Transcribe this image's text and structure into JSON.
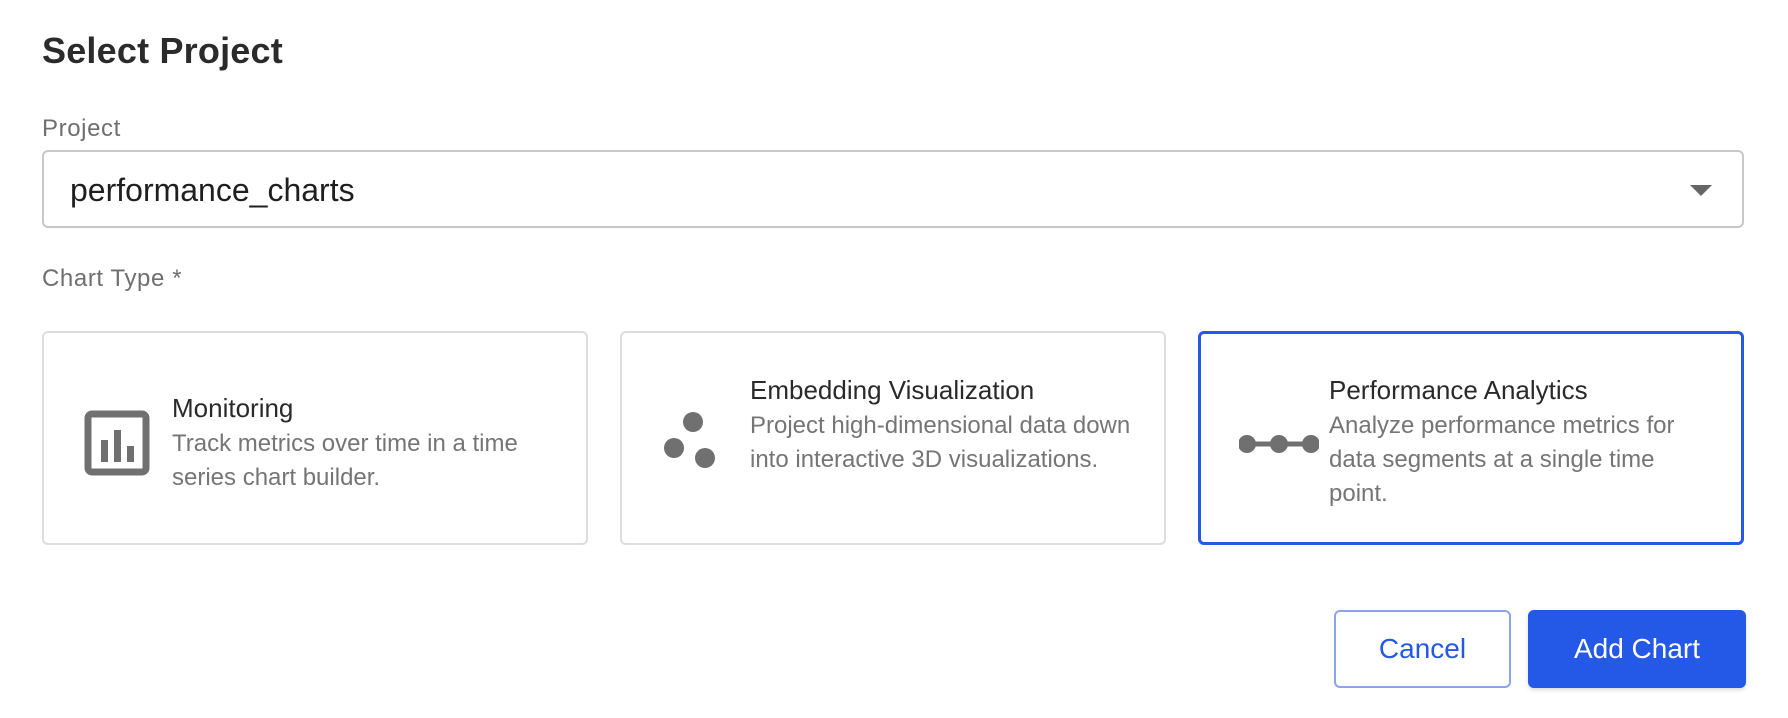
{
  "dialog": {
    "title": "Select Project"
  },
  "project": {
    "label": "Project",
    "selected": "performance_charts"
  },
  "chart_type": {
    "label": "Chart Type *",
    "options": [
      {
        "title": "Monitoring",
        "description": "Track metrics over time in a time series chart builder.",
        "icon": "bar-chart-icon",
        "selected": false
      },
      {
        "title": "Embedding Visualization",
        "description": "Project high-dimensional data down into interactive 3D visualizations.",
        "icon": "scatter-dots-icon",
        "selected": false
      },
      {
        "title": "Performance Analytics",
        "description": "Analyze performance metrics for data segments at a single time point.",
        "icon": "connected-dots-icon",
        "selected": true
      }
    ]
  },
  "buttons": {
    "cancel": "Cancel",
    "add": "Add Chart"
  },
  "colors": {
    "accent": "#2458e6",
    "icon": "#707070",
    "border": "#dddddd"
  }
}
